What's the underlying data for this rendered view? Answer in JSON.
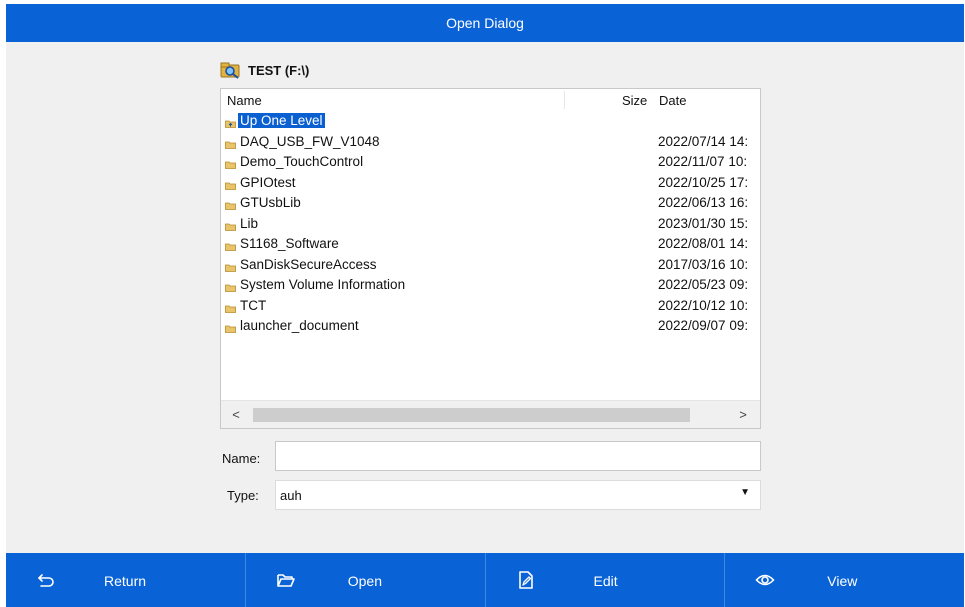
{
  "window": {
    "title": "Open Dialog"
  },
  "location": {
    "label": "TEST (F:\\)"
  },
  "file_list": {
    "columns": {
      "name": "Name",
      "size": "Size",
      "date": "Date"
    },
    "items": [
      {
        "name": "Up One Level",
        "date": "",
        "selected": true,
        "icon": "up-level-icon"
      },
      {
        "name": "DAQ_USB_FW_V1048",
        "date": "2022/07/14 14:",
        "icon": "folder-icon"
      },
      {
        "name": "Demo_TouchControl",
        "date": "2022/11/07 10:",
        "icon": "folder-icon"
      },
      {
        "name": "GPIOtest",
        "date": "2022/10/25 17:",
        "icon": "folder-icon"
      },
      {
        "name": "GTUsbLib",
        "date": "2022/06/13 16:",
        "icon": "folder-icon"
      },
      {
        "name": "Lib",
        "date": "2023/01/30 15:",
        "icon": "folder-icon"
      },
      {
        "name": "S1168_Software",
        "date": "2022/08/01 14:",
        "icon": "folder-icon"
      },
      {
        "name": "SanDiskSecureAccess",
        "date": "2017/03/16 10:",
        "icon": "folder-icon"
      },
      {
        "name": "System Volume Information",
        "date": "2022/05/23 09:",
        "icon": "folder-icon"
      },
      {
        "name": "TCT",
        "date": "2022/10/12 10:",
        "icon": "folder-icon"
      },
      {
        "name": "launcher_document",
        "date": "2022/09/07 09:",
        "icon": "folder-icon"
      }
    ],
    "scroll": {
      "left": "<",
      "right": ">"
    }
  },
  "form": {
    "name_label": "Name:",
    "name_value": "",
    "type_label": "Type:",
    "type_value": "auh"
  },
  "toolbar": {
    "return_label": "Return",
    "open_label": "Open",
    "edit_label": "Edit",
    "view_label": "View"
  },
  "colors": {
    "accent": "#0a63d6",
    "selection": "#0a5fd1",
    "panel": "#f0f0f0"
  }
}
